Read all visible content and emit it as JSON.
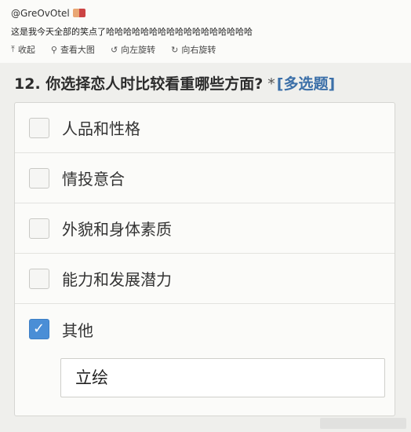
{
  "post": {
    "username": "@GreOvOtel",
    "text": "这是我今天全部的笑点了哈哈哈哈哈哈哈哈哈哈哈哈哈哈哈哈哈",
    "actions": [
      {
        "icon": "collapse-icon",
        "glyph": "⤒",
        "label": "收起"
      },
      {
        "icon": "search-icon",
        "glyph": "⚲",
        "label": "查看大图"
      },
      {
        "icon": "rotate-left-icon",
        "glyph": "↺",
        "label": "向左旋转"
      },
      {
        "icon": "rotate-right-icon",
        "glyph": "↻",
        "label": "向右旋转"
      }
    ]
  },
  "question": {
    "title": "12. 你选择恋人时比较看重哪些方面?",
    "required_mark": "*",
    "type_label": "[多选题]",
    "options": [
      {
        "label": "人品和性格",
        "checked": false
      },
      {
        "label": "情投意合",
        "checked": false
      },
      {
        "label": "外貌和身体素质",
        "checked": false
      },
      {
        "label": "能力和发展潜力",
        "checked": false
      },
      {
        "label": "其他",
        "checked": true
      }
    ],
    "other_input_value": "立绘"
  },
  "colors": {
    "accent": "#4a8ed6",
    "link": "#3b6fa8"
  }
}
